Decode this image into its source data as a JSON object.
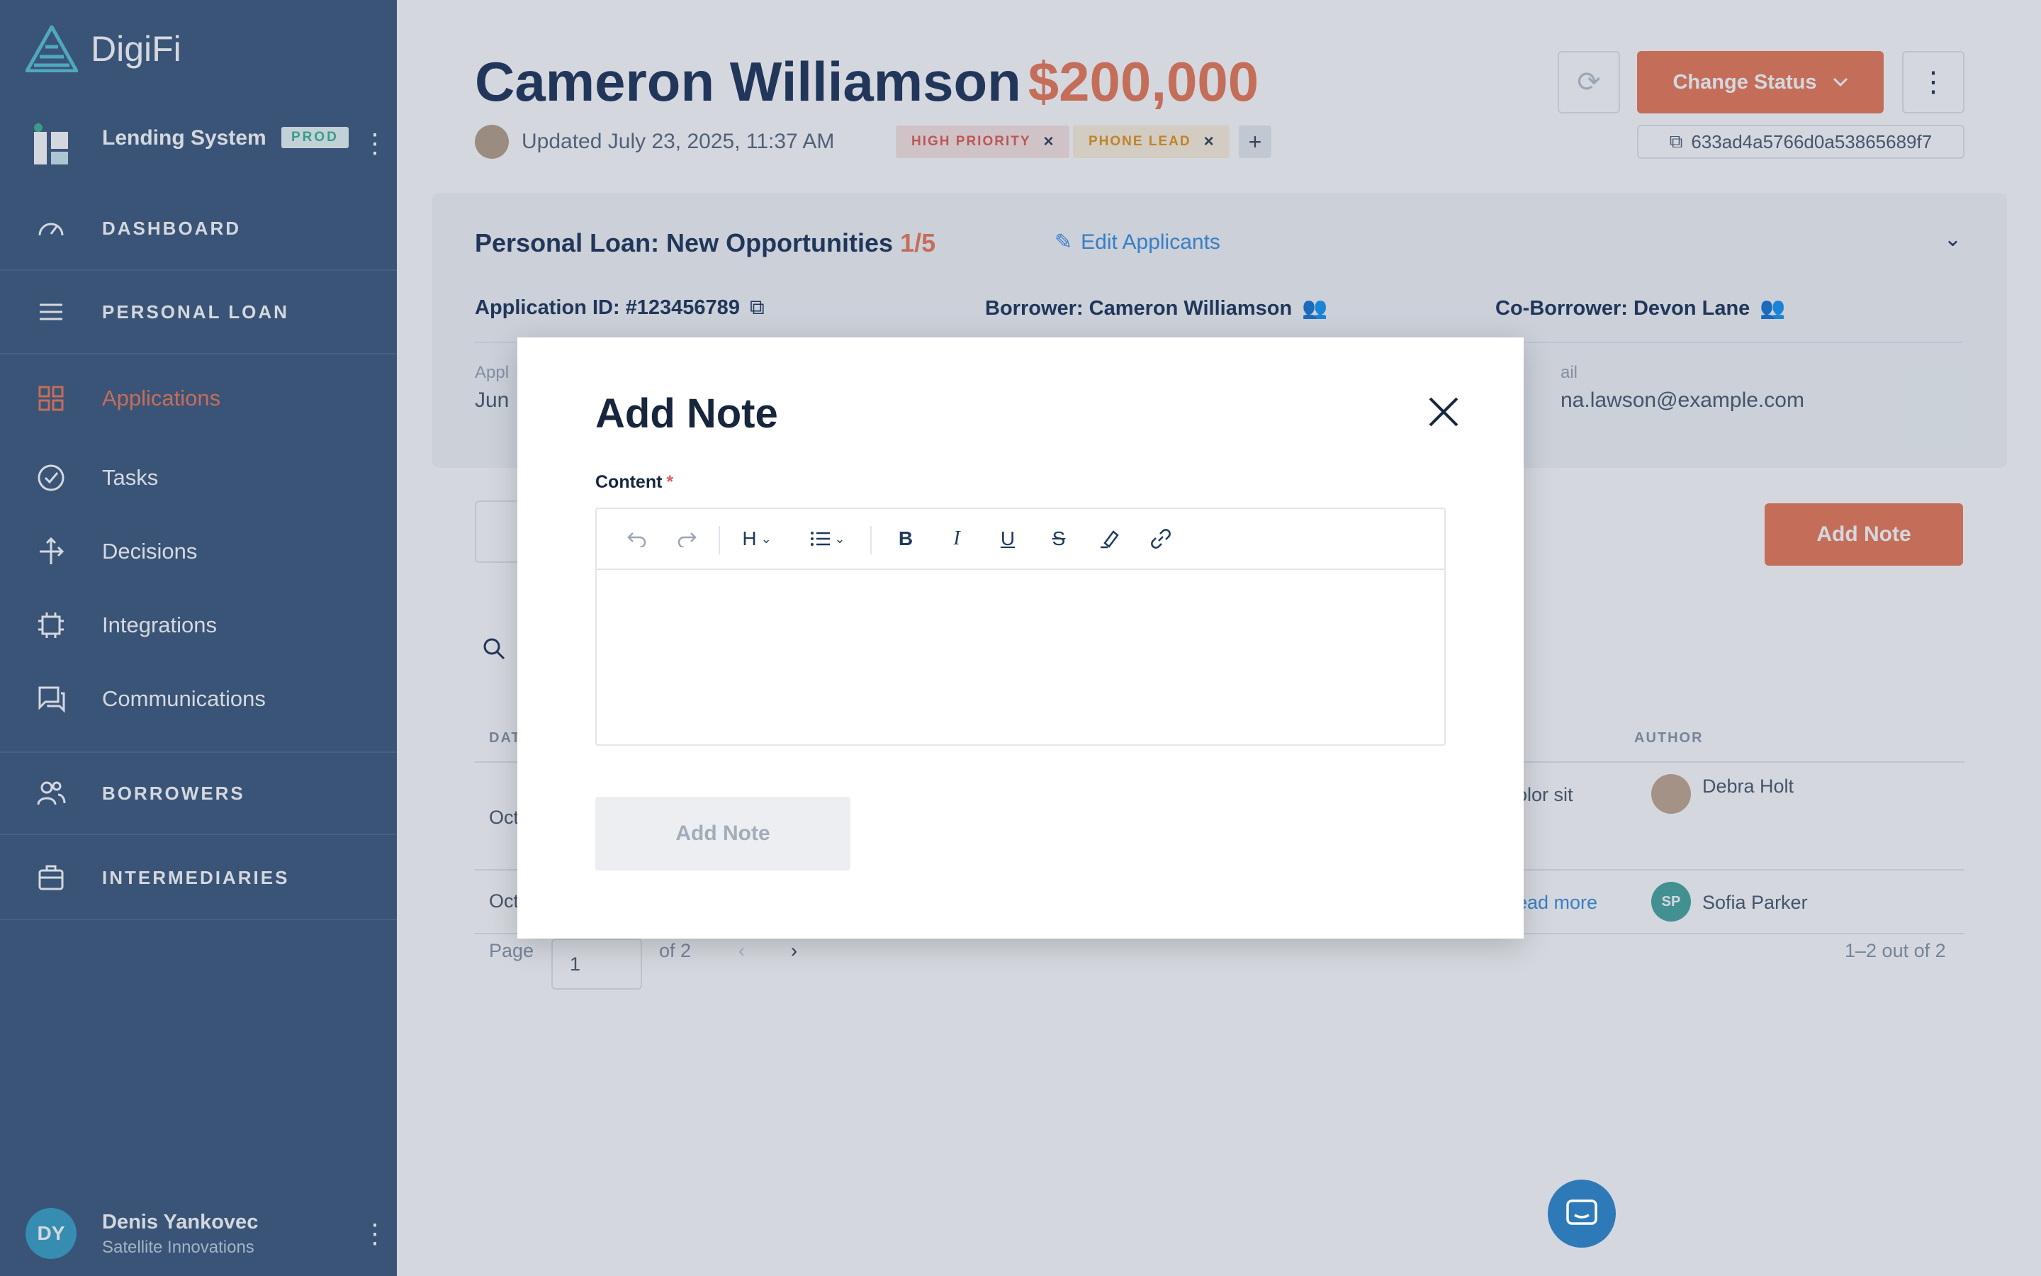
{
  "app": {
    "brand": "DigiFi",
    "system_name": "Lending System",
    "env_badge": "PROD"
  },
  "sidebar": {
    "sections": [
      {
        "label": "DASHBOARD",
        "icon": "gauge-icon"
      },
      {
        "label": "PERSONAL LOAN",
        "icon": "menu-icon"
      },
      {
        "label": "BORROWERS",
        "icon": "people-icon"
      },
      {
        "label": "INTERMEDIARIES",
        "icon": "briefcase-icon"
      }
    ],
    "items": [
      {
        "label": "Applications",
        "icon": "grid-icon",
        "active": true
      },
      {
        "label": "Tasks",
        "icon": "check-circle-icon"
      },
      {
        "label": "Decisions",
        "icon": "arrows-icon"
      },
      {
        "label": "Integrations",
        "icon": "chip-icon"
      },
      {
        "label": "Communications",
        "icon": "chat-icon"
      }
    ],
    "user": {
      "initials": "DY",
      "name": "Denis Yankovec",
      "org": "Satellite Innovations"
    }
  },
  "header": {
    "name": "Cameron Williamson",
    "amount": "$200,000",
    "updated": "Updated July 23, 2025, 11:37 AM",
    "tags": [
      {
        "label": "HIGH PRIORITY",
        "bg": "#fbe5e3",
        "fg": "#e25d55"
      },
      {
        "label": "PHONE LEAD",
        "bg": "#fdf0dd",
        "fg": "#e6951c"
      }
    ],
    "add_tag": "+",
    "change_status": "Change Status",
    "record_id": "633ad4a5766d0a53865689f7"
  },
  "panel": {
    "title": "Personal Loan: New Opportunities",
    "stage_fraction": "1/5",
    "edit_link": "Edit Applicants",
    "application_id": "Application ID: #123456789",
    "borrower": "Borrower: Cameron Williamson",
    "co_borrower": "Co-Borrower: Devon Lane",
    "label_left": "Appl",
    "value_left": "Jun",
    "label_right": "ail",
    "value_right": "na.lawson@example.com"
  },
  "notes": {
    "add_button": "Add Note",
    "columns": {
      "date": "DAT",
      "author": "AUTHOR"
    },
    "rows": [
      {
        "date": "Oct",
        "snippet": "olor sit",
        "author": "Debra Holt",
        "avatar_color": "#c4a892"
      },
      {
        "date": "Oct",
        "snippet": "ead more",
        "author": "Sofia Parker",
        "initials": "SP"
      }
    ],
    "pager": {
      "label": "Page",
      "value": "1",
      "of": "of 2",
      "summary": "1–2 out of 2"
    }
  },
  "modal": {
    "title": "Add Note",
    "content_label": "Content",
    "required_mark": "*",
    "toolbar": {
      "heading": "H",
      "tools": [
        "undo-icon",
        "redo-icon",
        "heading-dropdown",
        "list-dropdown",
        "bold-icon",
        "italic-icon",
        "underline-icon",
        "strikethrough-icon",
        "highlight-icon",
        "link-icon"
      ]
    },
    "submit": "Add Note"
  },
  "colors": {
    "sidebar": "#3e5a7f",
    "accent": "#ec7b5b",
    "link": "#3d8fe0"
  }
}
